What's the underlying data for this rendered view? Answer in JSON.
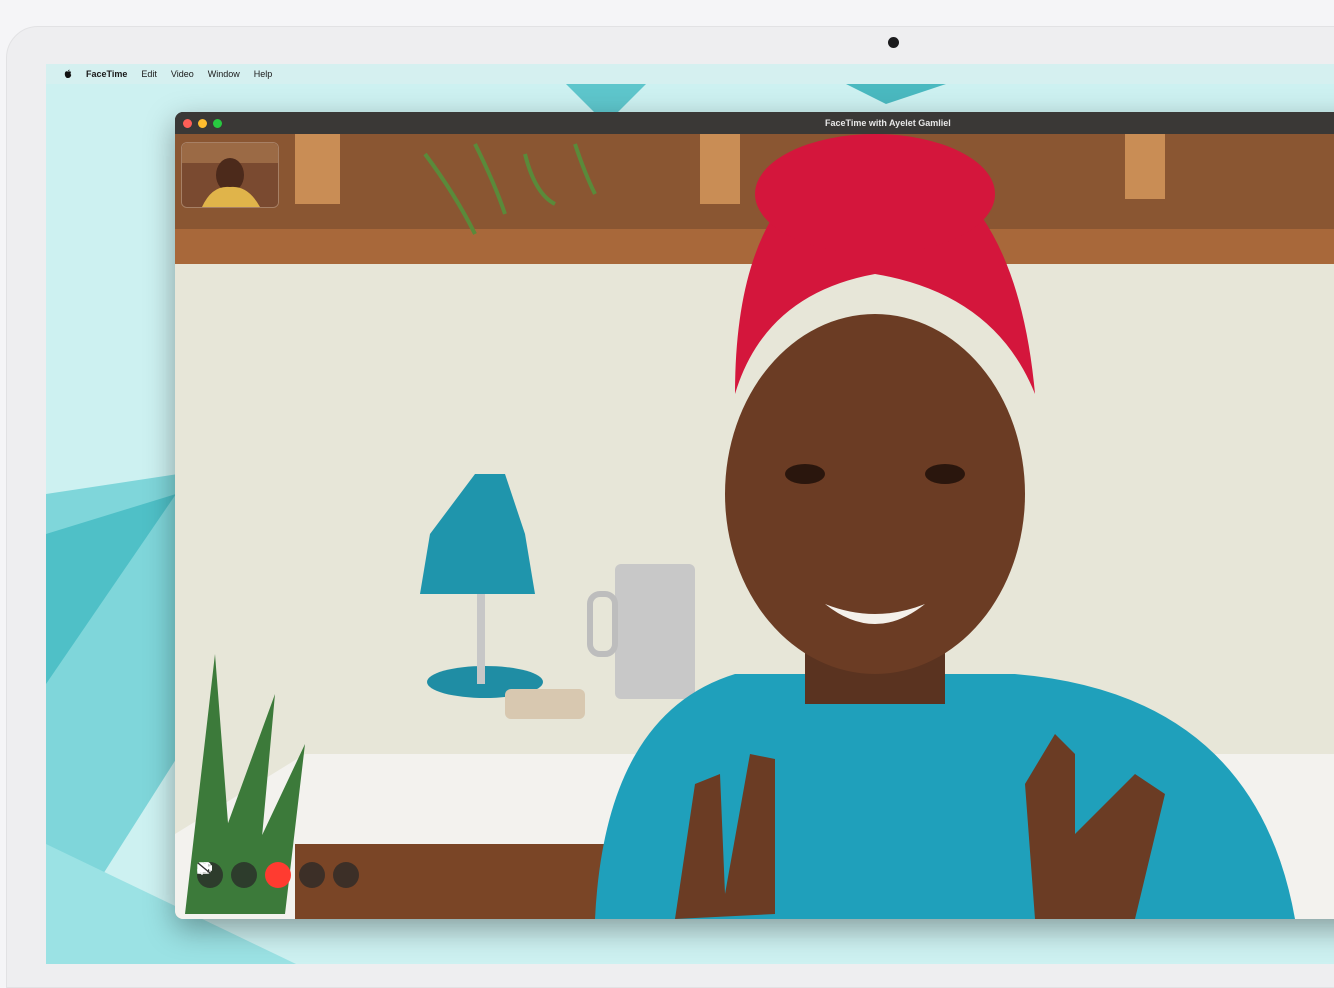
{
  "menubar": {
    "app_name": "FaceTime",
    "items": [
      "Edit",
      "Video",
      "Window",
      "Help"
    ]
  },
  "window": {
    "title": "FaceTime with Ayelet Gamliel"
  },
  "controls": {
    "sidebar_icon": "sidebar-icon",
    "mute_icon": "microphone-icon",
    "end_icon": "end-call-x-icon",
    "video_icon": "video-camera-off-icon",
    "fullscreen_icon": "fullscreen-arrows-icon"
  },
  "colors": {
    "end_call": "#ff3b30",
    "traffic_red": "#ff5f57",
    "traffic_yellow": "#febc2e",
    "traffic_green": "#28c840",
    "wallpaper": "#c9eff0"
  }
}
